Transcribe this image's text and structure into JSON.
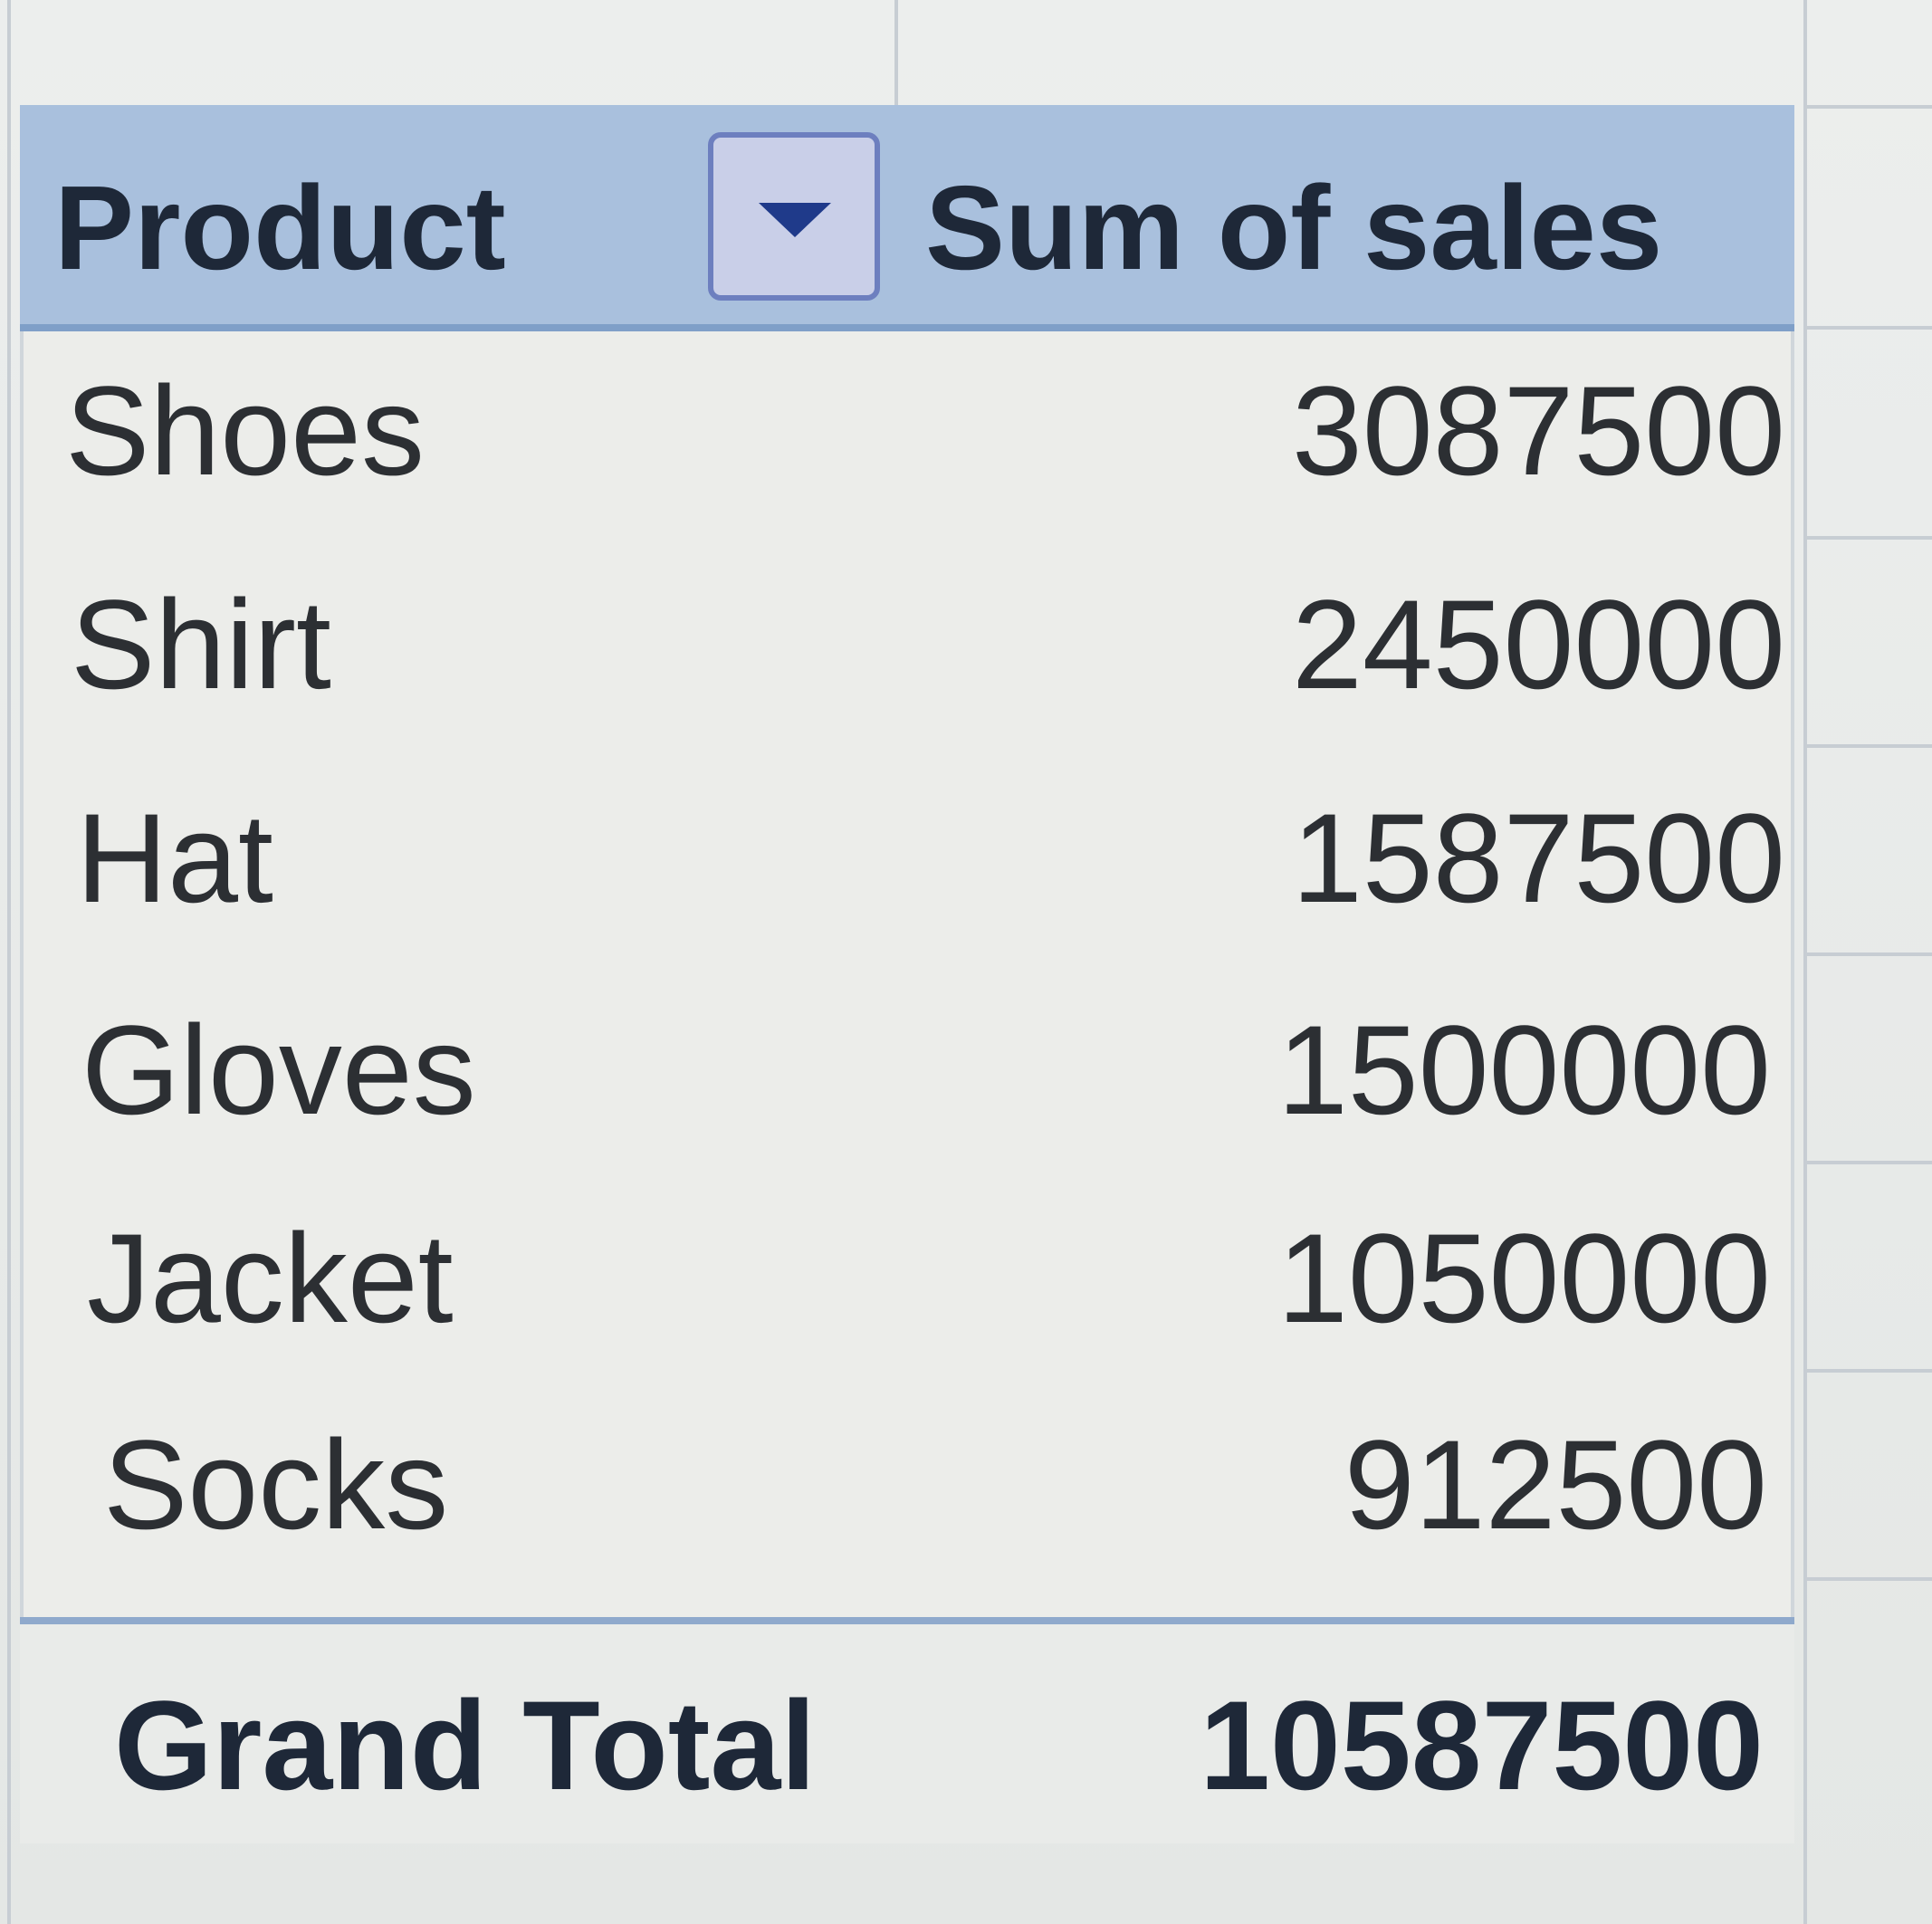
{
  "pivot_table": {
    "headers": {
      "row_field": "Product",
      "value_field": "Sum of sales"
    },
    "filter_icon": "dropdown-arrow-icon",
    "rows": [
      {
        "product": "Shoes",
        "sum_of_sales": "3087500"
      },
      {
        "product": "Shirt",
        "sum_of_sales": "2450000"
      },
      {
        "product": "Hat",
        "sum_of_sales": "1587500"
      },
      {
        "product": "Gloves",
        "sum_of_sales": "1500000"
      },
      {
        "product": "Jacket",
        "sum_of_sales": "1050000"
      },
      {
        "product": "Socks",
        "sum_of_sales": "912500"
      }
    ],
    "grand_total": {
      "label": "Grand Total",
      "value": "10587500"
    },
    "colors": {
      "header_fill": "#a9c0dd",
      "header_border": "#7f9fc8",
      "text": "#2c2f33"
    }
  }
}
